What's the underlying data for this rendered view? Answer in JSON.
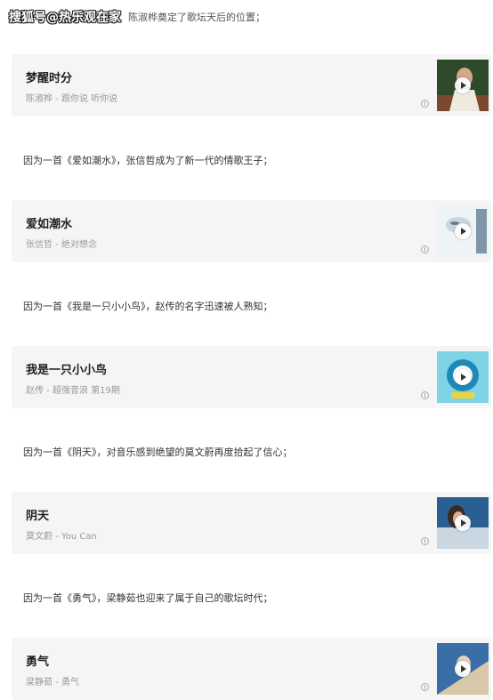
{
  "header": {
    "watermark": "搜狐号@热乐观在家",
    "text": "陈淑桦奠定了歌坛天后的位置；"
  },
  "cards": [
    {
      "title": "梦醒时分",
      "subtitle": "陈淑桦 - 跟你说 听你说",
      "thumb_colors": [
        "#2f4a2a",
        "#c9c6b8"
      ]
    },
    {
      "title": "爱如潮水",
      "subtitle": "张信哲 - 绝对想念",
      "thumb_colors": [
        "#dfe8ee",
        "#8fa7b8"
      ]
    },
    {
      "title": "我是一只小小鸟",
      "subtitle": "赵传 - 超强音浪 第19期",
      "thumb_colors": [
        "#22a6c8",
        "#f0d23a"
      ]
    },
    {
      "title": "阴天",
      "subtitle": "莫文蔚 - You Can",
      "thumb_colors": [
        "#2a5f93",
        "#c9d7e3"
      ]
    },
    {
      "title": "勇气",
      "subtitle": "梁静茹 - 勇气",
      "thumb_colors": [
        "#3a6ea8",
        "#d8c7a8"
      ]
    }
  ],
  "paragraphs": [
    "因为一首《爱如潮水》，张信哲成为了新一代的情歌王子；",
    "因为一首《我是一只小小鸟》，赵传的名字迅速被人熟知；",
    "因为一首《阴天》，对音乐感到绝望的莫文蔚再度拾起了信心；",
    "因为一首《勇气》，梁静茹也迎来了属于自己的歌坛时代；"
  ]
}
